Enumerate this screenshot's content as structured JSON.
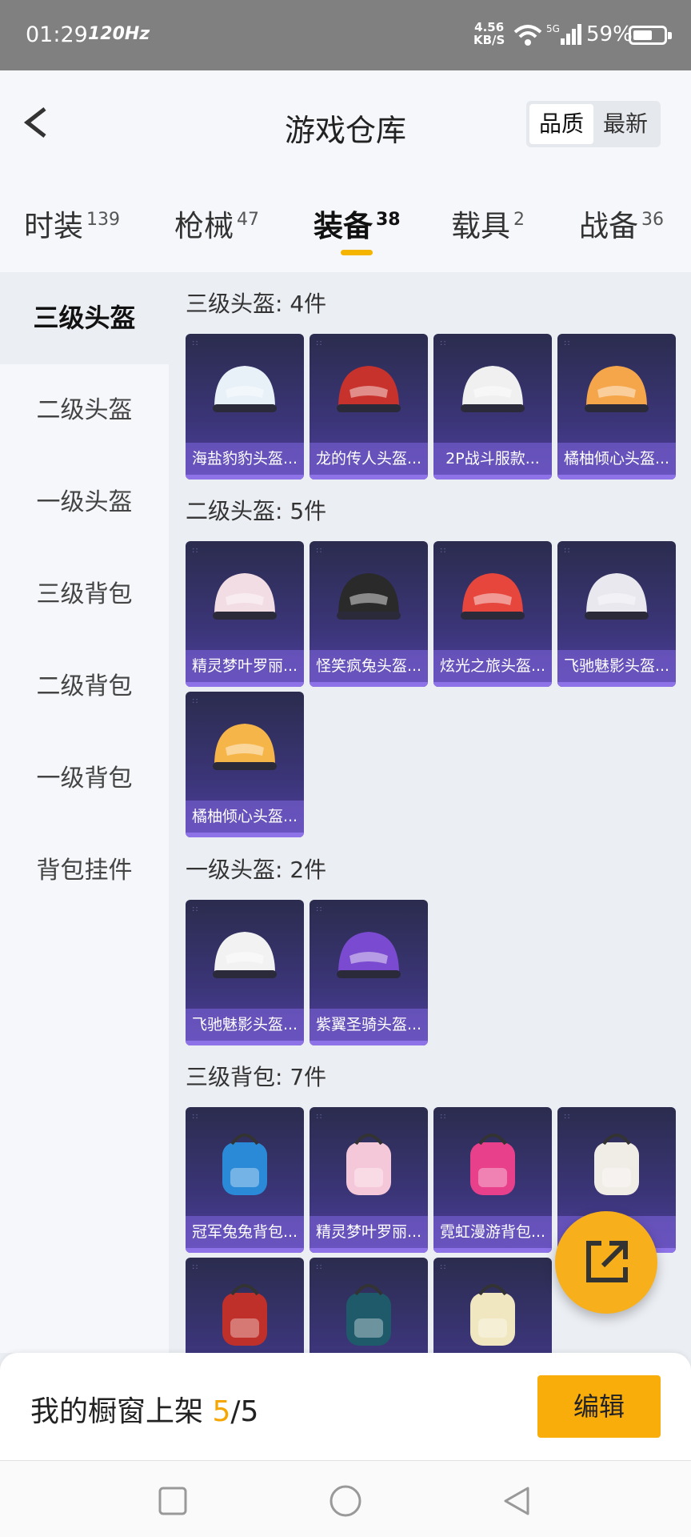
{
  "status_bar": {
    "time": "01:29",
    "refresh_rate": "120Hz",
    "net_speed_value": "4.56",
    "net_speed_unit": "KB/S",
    "network": "5G",
    "battery": "59%"
  },
  "header": {
    "title": "游戏仓库",
    "sort": {
      "active": "品质",
      "inactive": "最新"
    }
  },
  "tabs": [
    {
      "label": "时装",
      "count": "139"
    },
    {
      "label": "枪械",
      "count": "47"
    },
    {
      "label": "装备",
      "count": "38",
      "active": true
    },
    {
      "label": "载具",
      "count": "2"
    },
    {
      "label": "战备",
      "count": "36"
    }
  ],
  "sidebar": {
    "items": [
      {
        "label": "三级头盔",
        "active": true
      },
      {
        "label": "二级头盔"
      },
      {
        "label": "一级头盔"
      },
      {
        "label": "三级背包"
      },
      {
        "label": "二级背包"
      },
      {
        "label": "一级背包"
      },
      {
        "label": "背包挂件"
      }
    ]
  },
  "sections": [
    {
      "title": "三级头盔: 4件",
      "items": [
        {
          "label": "海盐豹豹头盔...",
          "icon": "helmet-seal-icon",
          "color": "#e8f0f8"
        },
        {
          "label": "龙的传人头盔...",
          "icon": "helmet-dragon-icon",
          "color": "#c8322c"
        },
        {
          "label": "2P战斗服款...",
          "icon": "helmet-2p-icon",
          "color": "#f0f0f0"
        },
        {
          "label": "橘柚倾心头盔...",
          "icon": "helmet-orange-icon",
          "color": "#f6a64a"
        }
      ]
    },
    {
      "title": "二级头盔: 5件",
      "items": [
        {
          "label": "精灵梦叶罗丽...",
          "icon": "helmet-fairy-icon",
          "color": "#f3dde4"
        },
        {
          "label": "怪笑疯兔头盔...",
          "icon": "helmet-rabbit-icon",
          "color": "#2a2a2a"
        },
        {
          "label": "炫光之旅头盔...",
          "icon": "helmet-journey-icon",
          "color": "#e6463c"
        },
        {
          "label": "飞驰魅影头盔...",
          "icon": "helmet-phantom-icon",
          "color": "#e8e8ee"
        },
        {
          "label": "橘柚倾心头盔...",
          "icon": "helmet-orange2-icon",
          "color": "#f6b548"
        }
      ]
    },
    {
      "title": "一级头盔: 2件",
      "items": [
        {
          "label": "飞驰魅影头盔...",
          "icon": "helmet-phantom1-icon",
          "color": "#f2f2f2"
        },
        {
          "label": "紫翼圣骑头盔...",
          "icon": "helmet-paladin-icon",
          "color": "#7a4bd0"
        }
      ]
    },
    {
      "title": "三级背包: 7件",
      "items": [
        {
          "label": "冠军兔兔背包...",
          "icon": "backpack-champion-icon",
          "color": "#2a8ad8"
        },
        {
          "label": "精灵梦叶罗丽...",
          "icon": "backpack-fairy-icon",
          "color": "#f4c8d8"
        },
        {
          "label": "霓虹漫游背包...",
          "icon": "backpack-neon-icon",
          "color": "#e8408a"
        },
        {
          "label": "",
          "icon": "backpack-white-icon",
          "color": "#f0ece6"
        },
        {
          "label": "",
          "icon": "backpack-red-icon",
          "color": "#c0302a"
        },
        {
          "label": "",
          "icon": "backpack-dark-icon",
          "color": "#1e5a6a"
        },
        {
          "label": "",
          "icon": "backpack-yellow-icon",
          "color": "#f0e6c0"
        }
      ]
    }
  ],
  "bottom_bar": {
    "label": "我的橱窗上架",
    "current": "5",
    "total": "/5",
    "edit_label": "编辑"
  },
  "colors": {
    "accent": "#f8ad0b",
    "card_bg": "#3b3578",
    "card_label_bg": "#7860d2"
  }
}
